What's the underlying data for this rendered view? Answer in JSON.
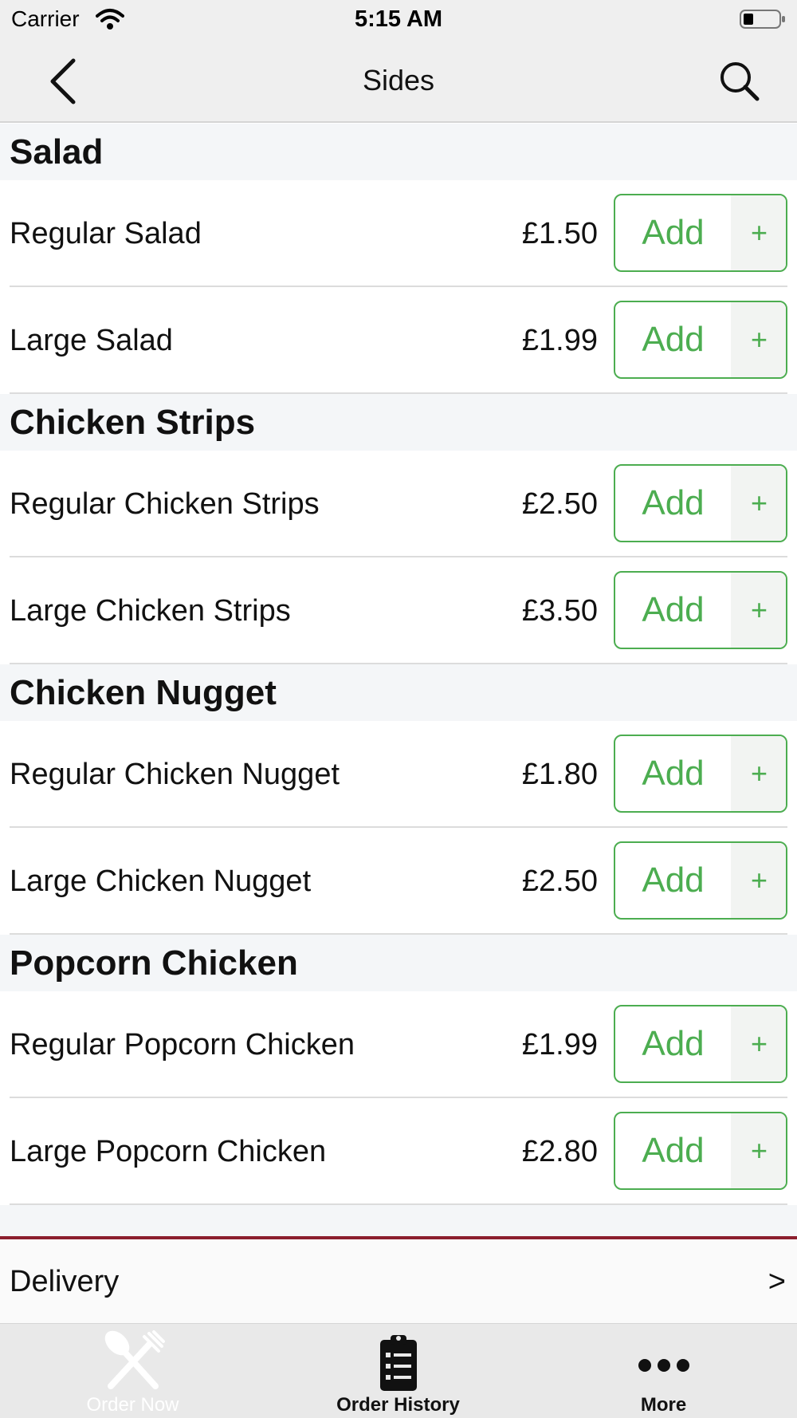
{
  "status_bar": {
    "carrier": "Carrier",
    "time": "5:15 AM",
    "wifi_icon": "wifi-icon",
    "battery_icon": "battery-icon"
  },
  "nav": {
    "title": "Sides",
    "back_icon": "chevron-left-icon",
    "search_icon": "search-icon"
  },
  "accent_color": "#4cad50",
  "divider_color": "#8b1e2d",
  "sections": [
    {
      "title": "Salad",
      "items": [
        {
          "name": "Regular Salad",
          "price": "£1.50",
          "add": "Add",
          "plus": "+"
        },
        {
          "name": "Large Salad",
          "price": "£1.99",
          "add": "Add",
          "plus": "+"
        }
      ]
    },
    {
      "title": "Chicken Strips",
      "items": [
        {
          "name": "Regular Chicken Strips",
          "price": "£2.50",
          "add": "Add",
          "plus": "+"
        },
        {
          "name": "Large Chicken Strips",
          "price": "£3.50",
          "add": "Add",
          "plus": "+"
        }
      ]
    },
    {
      "title": "Chicken Nugget",
      "items": [
        {
          "name": "Regular Chicken Nugget",
          "price": "£1.80",
          "add": "Add",
          "plus": "+"
        },
        {
          "name": "Large Chicken Nugget",
          "price": "£2.50",
          "add": "Add",
          "plus": "+"
        }
      ]
    },
    {
      "title": "Popcorn Chicken",
      "items": [
        {
          "name": "Regular Popcorn Chicken",
          "price": "£1.99",
          "add": "Add",
          "plus": "+"
        },
        {
          "name": "Large Popcorn Chicken",
          "price": "£2.80",
          "add": "Add",
          "plus": "+"
        }
      ]
    }
  ],
  "delivery": {
    "label": "Delivery",
    "chevron": ">"
  },
  "tabs": [
    {
      "label": "Order Now",
      "icon": "fork-knife-icon",
      "active": false
    },
    {
      "label": "Order History",
      "icon": "clipboard-list-icon",
      "active": true
    },
    {
      "label": "More",
      "icon": "more-dots-icon",
      "active": true
    }
  ]
}
